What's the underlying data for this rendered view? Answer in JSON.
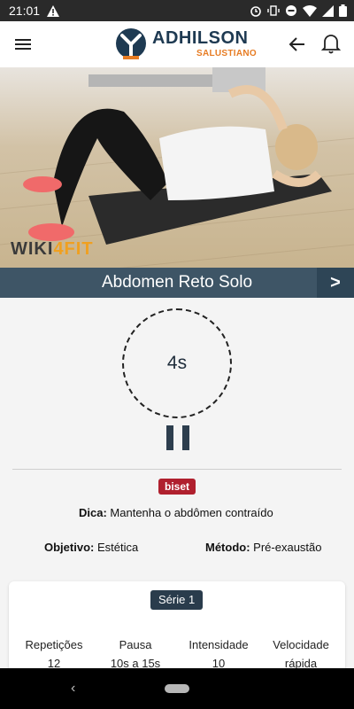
{
  "status_bar": {
    "time": "21:01",
    "icons": [
      "warning-icon",
      "alarm-icon",
      "vibrate-icon",
      "dnd-icon",
      "wifi-icon",
      "signal-icon",
      "battery-icon"
    ]
  },
  "header": {
    "brand": "ADHILSON",
    "brand_sub": "SALUSTIANO",
    "colors": {
      "brand_dark": "#1e3a52",
      "brand_orange": "#e77c23"
    }
  },
  "exercise": {
    "watermark_1": "WIKI",
    "watermark_2": "4FIT",
    "title": "Abdomen Reto Solo",
    "next_label": ">",
    "timer": "4s",
    "badge": "biset",
    "dica_label": "Dica:",
    "dica_value": "Mantenha o abdômen contraído",
    "objetivo_label": "Objetivo:",
    "objetivo_value": "Estética",
    "metodo_label": "Método:",
    "metodo_value": "Pré-exaustão"
  },
  "serie": {
    "label": "Série 1",
    "columns": [
      {
        "header": "Repetições",
        "value": "12"
      },
      {
        "header": "Pausa",
        "value": "10s a 15s"
      },
      {
        "header": "Intensidade",
        "value": "10"
      },
      {
        "header": "Velocidade",
        "value": "rápida"
      }
    ]
  },
  "nav": {
    "back_glyph": "‹"
  }
}
